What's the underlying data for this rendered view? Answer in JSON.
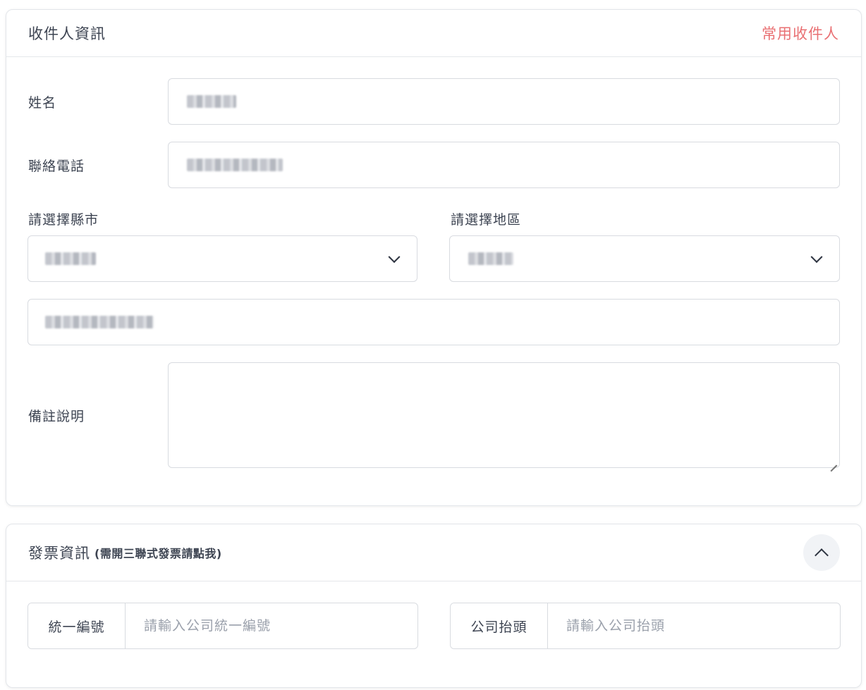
{
  "recipient": {
    "title": "收件人資訊",
    "frequent_link": "常用收件人",
    "name_label": "姓名",
    "phone_label": "聯絡電話",
    "city_label": "請選擇縣市",
    "district_label": "請選擇地區",
    "notes_label": "備註說明"
  },
  "invoice": {
    "title": "發票資訊",
    "hint": "(需開三聯式發票請點我)",
    "tax_id_label": "統一編號",
    "tax_id_placeholder": "請輸入公司統一編號",
    "company_label": "公司抬頭",
    "company_placeholder": "請輸入公司抬頭"
  },
  "icons": {
    "select_arrow": "chevron-down-icon",
    "collapse": "chevron-up-icon"
  },
  "colors": {
    "accent": "#e97073",
    "border": "#d8dbe0"
  }
}
